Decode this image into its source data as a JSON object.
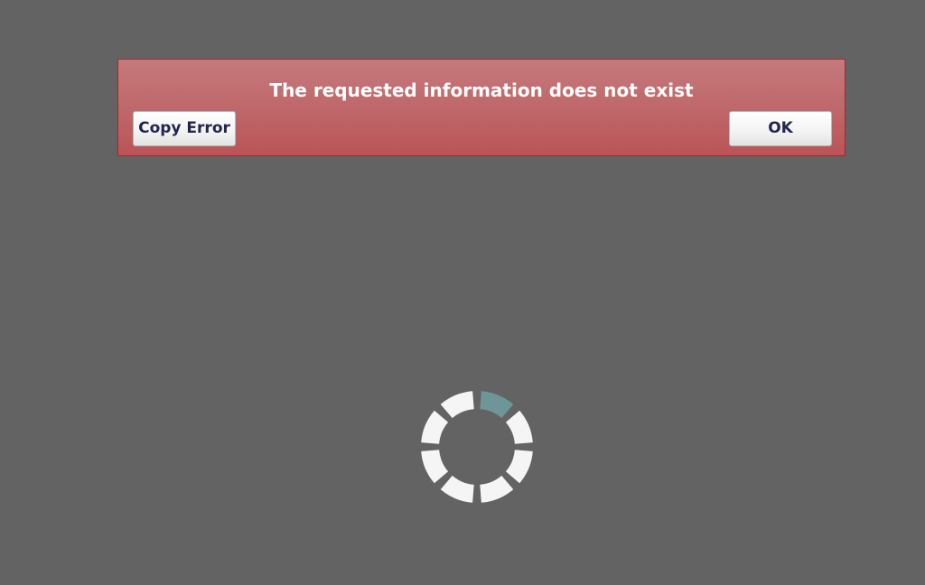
{
  "error_banner": {
    "message": "The requested information does not exist",
    "copy_button_label": "Copy Error",
    "ok_button_label": "OK"
  },
  "colors": {
    "background": "#636363",
    "banner_red": "#bf6669",
    "banner_border": "#9e2a2f",
    "button_text": "#23264e",
    "spinner_segment": "#f5f5f5",
    "spinner_active": "#6e9597"
  },
  "spinner": {
    "segments": 8,
    "active_segment": 0
  }
}
